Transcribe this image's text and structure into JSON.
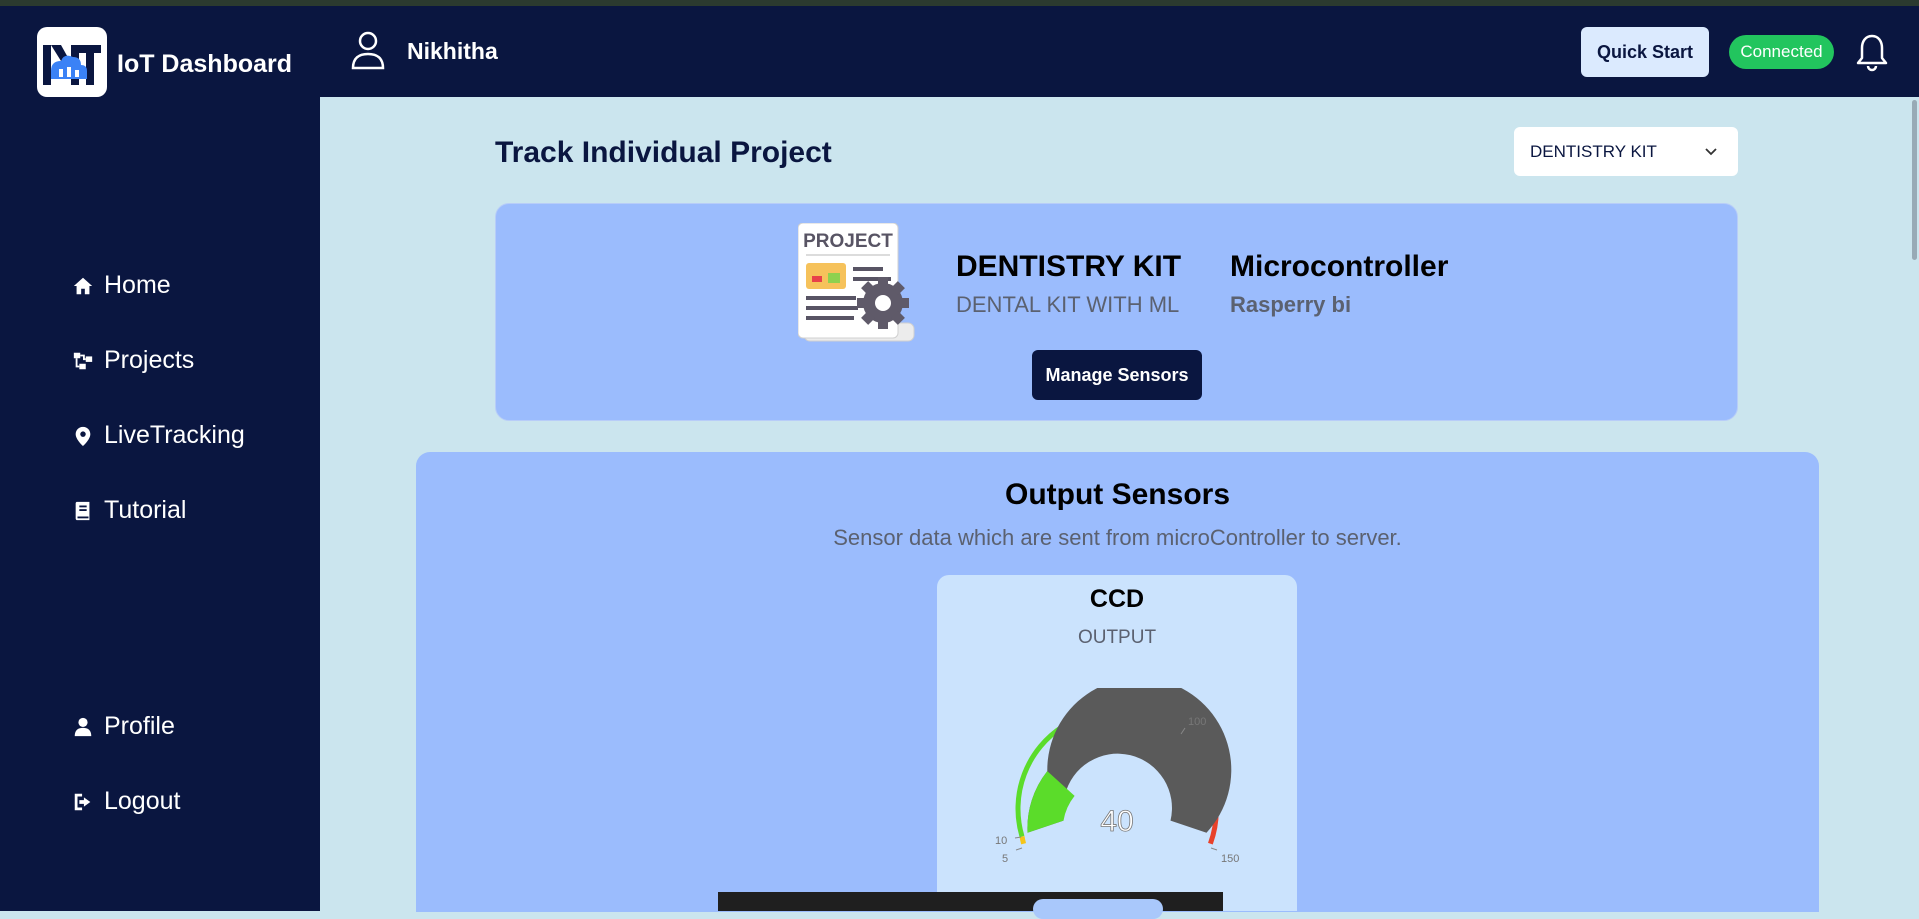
{
  "app": {
    "title": "IoT Dashboard"
  },
  "sidebar": {
    "items": [
      {
        "label": "Home",
        "icon": "home-icon"
      },
      {
        "label": "Projects",
        "icon": "diagram-icon"
      },
      {
        "label": "LiveTracking",
        "icon": "map-pin-icon"
      },
      {
        "label": "Tutorial",
        "icon": "book-icon"
      }
    ],
    "bottom_items": [
      {
        "label": "Profile",
        "icon": "user-icon"
      },
      {
        "label": "Logout",
        "icon": "logout-icon"
      }
    ]
  },
  "header": {
    "user_name": "Nikhitha",
    "quick_start_label": "Quick Start",
    "status": "Connected"
  },
  "main": {
    "page_title": "Track Individual Project",
    "project_select_value": "DENTISTRY KIT",
    "project": {
      "image_caption": "PROJECT",
      "name": "DENTISTRY KIT",
      "description": "DENTAL KIT WITH ML",
      "mc_label": "Microcontroller",
      "mc_value": "Rasperry bi",
      "manage_label": "Manage Sensors"
    },
    "output": {
      "title": "Output Sensors",
      "subtitle": "Sensor data which are sent from microController to server.",
      "sensor": {
        "name": "CCD",
        "type": "OUTPUT",
        "value": "40",
        "ticks": [
          "5",
          "10",
          "100",
          "150"
        ]
      }
    }
  },
  "colors": {
    "navy": "#0a1640",
    "panel": "#9bbcfd",
    "status": "#22c55e",
    "gauge_green": "#5bdc2a",
    "gauge_red": "#e8412a",
    "gauge_yellow": "#f5c518"
  }
}
